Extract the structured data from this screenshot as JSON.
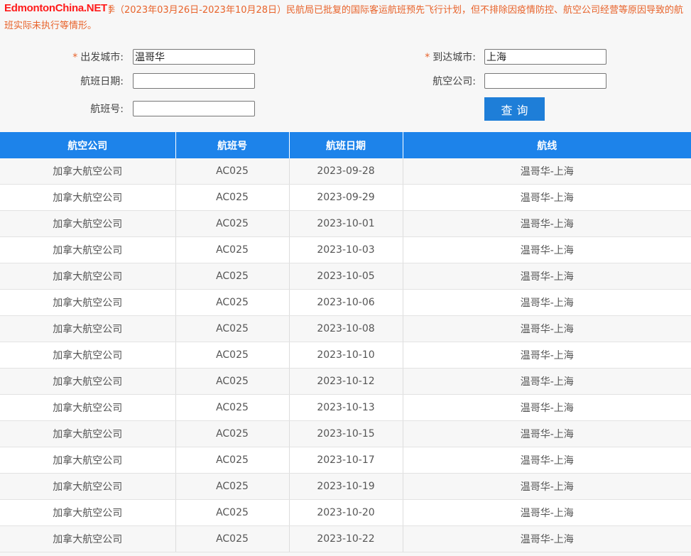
{
  "watermark": "EdmontonChina.NET",
  "notice": "以下查询的结果仅为本航季（2023年03月26日-2023年10月28日）民航局已批复的国际客运航班预先飞行计划，但不排除因疫情防控、航空公司经营等原因导致的航班实际未执行等情形。",
  "form": {
    "required_mark": "*",
    "departure_label": "出发城市:",
    "departure_value": "温哥华",
    "arrival_label": "到达城市:",
    "arrival_value": "上海",
    "date_label": "航班日期:",
    "date_value": "",
    "airline_label": "航空公司:",
    "airline_value": "",
    "flight_no_label": "航班号:",
    "flight_no_value": "",
    "query_button": "查询"
  },
  "table": {
    "headers": [
      "航空公司",
      "航班号",
      "航班日期",
      "航线"
    ],
    "rows": [
      [
        "加拿大航空公司",
        "AC025",
        "2023-09-28",
        "温哥华-上海"
      ],
      [
        "加拿大航空公司",
        "AC025",
        "2023-09-29",
        "温哥华-上海"
      ],
      [
        "加拿大航空公司",
        "AC025",
        "2023-10-01",
        "温哥华-上海"
      ],
      [
        "加拿大航空公司",
        "AC025",
        "2023-10-03",
        "温哥华-上海"
      ],
      [
        "加拿大航空公司",
        "AC025",
        "2023-10-05",
        "温哥华-上海"
      ],
      [
        "加拿大航空公司",
        "AC025",
        "2023-10-06",
        "温哥华-上海"
      ],
      [
        "加拿大航空公司",
        "AC025",
        "2023-10-08",
        "温哥华-上海"
      ],
      [
        "加拿大航空公司",
        "AC025",
        "2023-10-10",
        "温哥华-上海"
      ],
      [
        "加拿大航空公司",
        "AC025",
        "2023-10-12",
        "温哥华-上海"
      ],
      [
        "加拿大航空公司",
        "AC025",
        "2023-10-13",
        "温哥华-上海"
      ],
      [
        "加拿大航空公司",
        "AC025",
        "2023-10-15",
        "温哥华-上海"
      ],
      [
        "加拿大航空公司",
        "AC025",
        "2023-10-17",
        "温哥华-上海"
      ],
      [
        "加拿大航空公司",
        "AC025",
        "2023-10-19",
        "温哥华-上海"
      ],
      [
        "加拿大航空公司",
        "AC025",
        "2023-10-20",
        "温哥华-上海"
      ],
      [
        "加拿大航空公司",
        "AC025",
        "2023-10-22",
        "温哥华-上海"
      ]
    ]
  },
  "colors": {
    "notice": "#e8632b",
    "watermark": "#ff1a1a",
    "header_bg": "#1d83ea",
    "button_bg": "#1e7ed8"
  }
}
